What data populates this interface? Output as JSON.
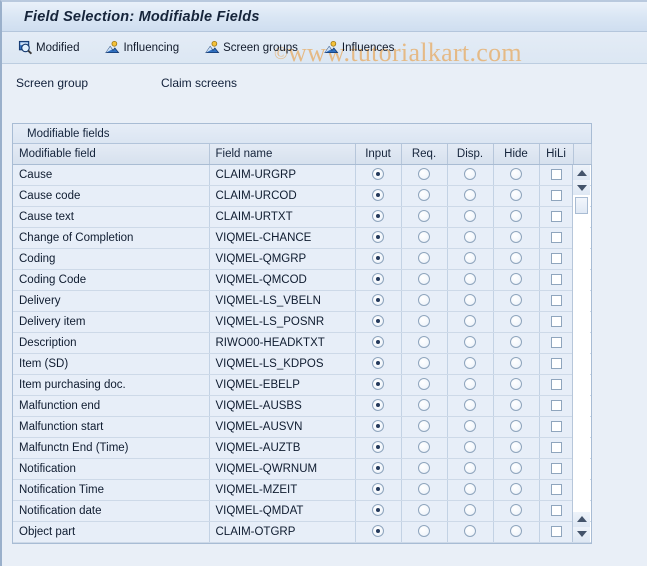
{
  "window": {
    "title": "Field Selection: Modifiable Fields"
  },
  "toolbar": {
    "buttons": [
      {
        "label": "Modified",
        "icon": "magnifier-icon"
      },
      {
        "label": "Influencing",
        "icon": "influence-icon"
      },
      {
        "label": "Screen groups",
        "icon": "influence-icon"
      },
      {
        "label": "Influences",
        "icon": "influence-icon"
      }
    ]
  },
  "watermark": {
    "symbol": "©",
    "text": "www.tutorialkart.com",
    "color": "#e8a85c"
  },
  "screen_group": {
    "label": "Screen group",
    "value": "Claim screens"
  },
  "table": {
    "panel_title": "Modifiable fields",
    "columns": [
      {
        "key": "field",
        "label": "Modifiable field"
      },
      {
        "key": "name",
        "label": "Field name"
      },
      {
        "key": "input",
        "label": "Input"
      },
      {
        "key": "req",
        "label": "Req."
      },
      {
        "key": "disp",
        "label": "Disp."
      },
      {
        "key": "hide",
        "label": "Hide"
      },
      {
        "key": "hili",
        "label": "HiLi"
      }
    ],
    "rows": [
      {
        "field": "Cause",
        "name": "CLAIM-URGRP",
        "input": true,
        "req": false,
        "disp": false,
        "hide": false,
        "hili": false
      },
      {
        "field": "Cause code",
        "name": "CLAIM-URCOD",
        "input": true,
        "req": false,
        "disp": false,
        "hide": false,
        "hili": false
      },
      {
        "field": "Cause text",
        "name": "CLAIM-URTXT",
        "input": true,
        "req": false,
        "disp": false,
        "hide": false,
        "hili": false
      },
      {
        "field": "Change of Completion",
        "name": "VIQMEL-CHANCE",
        "input": true,
        "req": false,
        "disp": false,
        "hide": false,
        "hili": false
      },
      {
        "field": "Coding",
        "name": "VIQMEL-QMGRP",
        "input": true,
        "req": false,
        "disp": false,
        "hide": false,
        "hili": false
      },
      {
        "field": "Coding Code",
        "name": "VIQMEL-QMCOD",
        "input": true,
        "req": false,
        "disp": false,
        "hide": false,
        "hili": false
      },
      {
        "field": "Delivery",
        "name": "VIQMEL-LS_VBELN",
        "input": true,
        "req": false,
        "disp": false,
        "hide": false,
        "hili": false
      },
      {
        "field": "Delivery item",
        "name": "VIQMEL-LS_POSNR",
        "input": true,
        "req": false,
        "disp": false,
        "hide": false,
        "hili": false
      },
      {
        "field": "Description",
        "name": "RIWO00-HEADKTXT",
        "input": true,
        "req": false,
        "disp": false,
        "hide": false,
        "hili": false
      },
      {
        "field": "Item (SD)",
        "name": "VIQMEL-LS_KDPOS",
        "input": true,
        "req": false,
        "disp": false,
        "hide": false,
        "hili": false
      },
      {
        "field": "Item purchasing doc.",
        "name": "VIQMEL-EBELP",
        "input": true,
        "req": false,
        "disp": false,
        "hide": false,
        "hili": false
      },
      {
        "field": "Malfunction end",
        "name": "VIQMEL-AUSBS",
        "input": true,
        "req": false,
        "disp": false,
        "hide": false,
        "hili": false
      },
      {
        "field": "Malfunction start",
        "name": "VIQMEL-AUSVN",
        "input": true,
        "req": false,
        "disp": false,
        "hide": false,
        "hili": false
      },
      {
        "field": "Malfunctn End (Time)",
        "name": "VIQMEL-AUZTB",
        "input": true,
        "req": false,
        "disp": false,
        "hide": false,
        "hili": false
      },
      {
        "field": "Notification",
        "name": "VIQMEL-QWRNUM",
        "input": true,
        "req": false,
        "disp": false,
        "hide": false,
        "hili": false
      },
      {
        "field": "Notification Time",
        "name": "VIQMEL-MZEIT",
        "input": true,
        "req": false,
        "disp": false,
        "hide": false,
        "hili": false
      },
      {
        "field": "Notification date",
        "name": "VIQMEL-QMDAT",
        "input": true,
        "req": false,
        "disp": false,
        "hide": false,
        "hili": false
      },
      {
        "field": "Object part",
        "name": "CLAIM-OTGRP",
        "input": true,
        "req": false,
        "disp": false,
        "hide": false,
        "hili": false
      }
    ]
  },
  "scrollbar": {
    "up_icon": "triangle-up-icon",
    "down_icon": "triangle-down-icon"
  }
}
